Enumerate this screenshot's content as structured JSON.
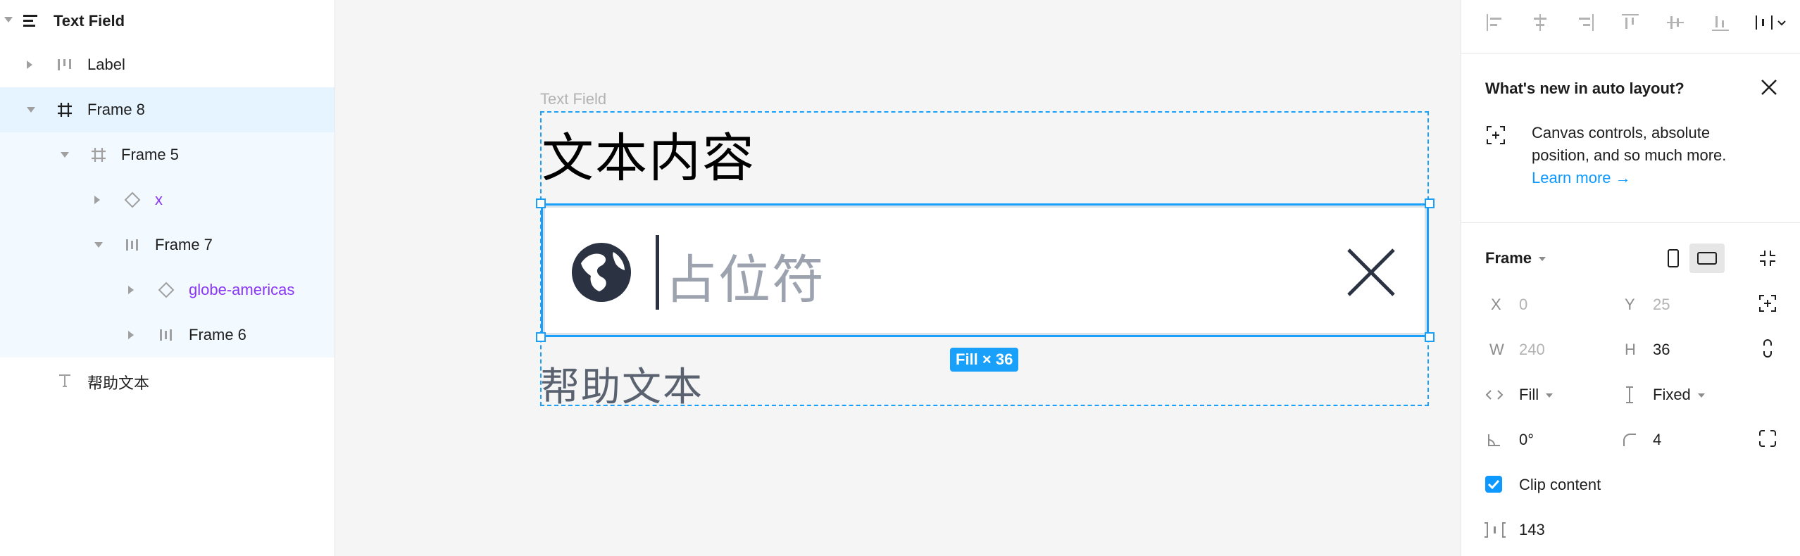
{
  "layers": {
    "root": "Text Field",
    "items": [
      {
        "label": "Label"
      },
      {
        "label": "Frame 8"
      },
      {
        "label": "Frame 5"
      },
      {
        "label": "x"
      },
      {
        "label": "Frame 7"
      },
      {
        "label": "globe-americas"
      },
      {
        "label": "Frame 6"
      },
      {
        "label": "帮助文本"
      }
    ]
  },
  "canvas": {
    "frame_tag": "Text Field",
    "title_text": "文本内容",
    "placeholder": "占位符",
    "size_badge": "Fill × 36",
    "help_text": "帮助文本"
  },
  "news": {
    "title": "What's new in auto layout?",
    "body": "Canvas controls, absolute position, and so much more.",
    "link": "Learn more →"
  },
  "props": {
    "section": "Frame",
    "x_label": "X",
    "x_value": "0",
    "y_label": "Y",
    "y_value": "25",
    "w_label": "W",
    "w_value": "240",
    "h_label": "H",
    "h_value": "36",
    "horizontal_sizing": "Fill",
    "vertical_sizing": "Fixed",
    "rotation": "0°",
    "radius": "4",
    "clip_content": "Clip content",
    "spacing": "143"
  },
  "colors": {
    "accent": "#18a0fb",
    "selected_row": "#e5f4ff",
    "child_row": "#f2f9ff",
    "component": "#8a38f5"
  }
}
